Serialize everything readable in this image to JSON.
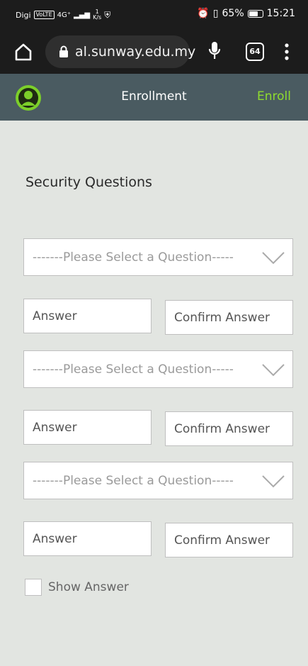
{
  "status_bar": {
    "carrier": "Digi",
    "volte": "VoLTE",
    "network": "4G⁺",
    "speed_value": "1",
    "speed_unit": "K/s",
    "battery_percent": "65%",
    "time": "15:21"
  },
  "browser": {
    "url": "al.sunway.edu.my",
    "tab_count": "64"
  },
  "header": {
    "title": "Enrollment",
    "action_label": "Enroll",
    "accent_color": "#8fdc2f",
    "bg_color": "#4a5b61"
  },
  "main": {
    "section_title": "Security Questions",
    "questions": [
      {
        "placeholder": "-------Please Select a Question-----",
        "answer_placeholder": "Answer",
        "confirm_placeholder": "Confirm Answer"
      },
      {
        "placeholder": "-------Please Select a Question-----",
        "answer_placeholder": "Answer",
        "confirm_placeholder": "Confirm Answer"
      },
      {
        "placeholder": "-------Please Select a Question-----",
        "answer_placeholder": "Answer",
        "confirm_placeholder": "Confirm Answer"
      }
    ],
    "show_answer_label": "Show Answer",
    "show_answer_checked": false
  }
}
